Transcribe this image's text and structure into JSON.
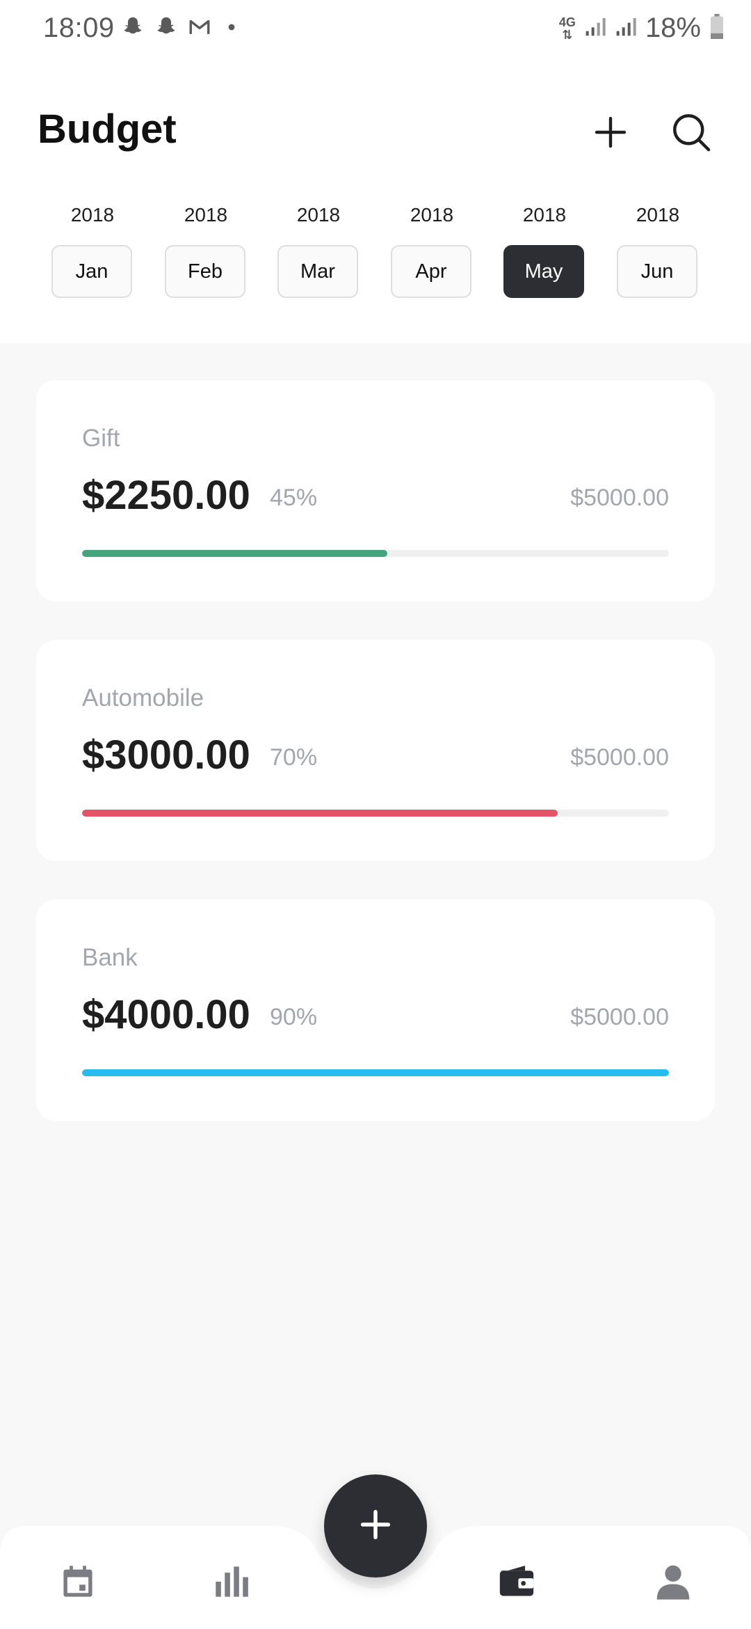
{
  "status_bar": {
    "time": "18:09",
    "network": "4G",
    "battery_percent": "18%",
    "notification_icons": [
      "snapchat-icon",
      "snapchat-icon",
      "gmail-icon",
      "dot-icon"
    ]
  },
  "header": {
    "title": "Budget",
    "add_icon": "plus-icon",
    "search_icon": "search-icon"
  },
  "months": [
    {
      "year": "2018",
      "label": "Jan",
      "selected": false
    },
    {
      "year": "2018",
      "label": "Feb",
      "selected": false
    },
    {
      "year": "2018",
      "label": "Mar",
      "selected": false
    },
    {
      "year": "2018",
      "label": "Apr",
      "selected": false
    },
    {
      "year": "2018",
      "label": "May",
      "selected": true
    },
    {
      "year": "2018",
      "label": "Jun",
      "selected": false
    }
  ],
  "budgets": [
    {
      "category": "Gift",
      "amount": "$2250.00",
      "percent": "45%",
      "total": "$5000.00",
      "progress": 0.52,
      "color": "#43a47d"
    },
    {
      "category": "Automobile",
      "amount": "$3000.00",
      "percent": "70%",
      "total": "$5000.00",
      "progress": 0.81,
      "color": "#e55466"
    },
    {
      "category": "Bank",
      "amount": "$4000.00",
      "percent": "90%",
      "total": "$5000.00",
      "progress": 1.0,
      "color": "#26bcef"
    }
  ],
  "colors": {
    "accent_dark": "#2c2e33",
    "muted_text": "#a2a6ad",
    "background": "#f8f8f8"
  },
  "bottom_nav": {
    "items": [
      "calendar-icon",
      "bar-chart-icon",
      "wallet-icon",
      "profile-icon"
    ],
    "active": "wallet-icon",
    "fab_icon": "plus-icon"
  }
}
